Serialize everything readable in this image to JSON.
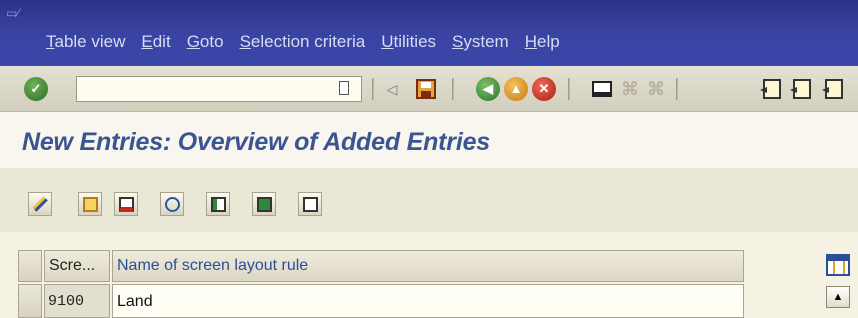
{
  "menubar": {
    "items": [
      {
        "underline": "T",
        "rest": "able view"
      },
      {
        "underline": "E",
        "rest": "dit"
      },
      {
        "underline": "G",
        "rest": "oto"
      },
      {
        "underline": "S",
        "rest": "election criteria"
      },
      {
        "underline": "U",
        "rest": "tilities"
      },
      {
        "underline": "S",
        "rest": "ystem"
      },
      {
        "underline": "H",
        "rest": "elp"
      }
    ]
  },
  "toolbar": {
    "command_value": "",
    "icons": [
      "enter-check-icon",
      "command-history-icon",
      "back-arrow-small-icon",
      "save-icon",
      "back-icon",
      "exit-icon",
      "cancel-icon",
      "print-icon",
      "find-icon",
      "find-next-icon",
      "first-page-icon",
      "previous-page-icon",
      "next-page-icon"
    ]
  },
  "page": {
    "title": "New Entries: Overview of Added Entries"
  },
  "app_toolbar": {
    "icons": [
      "change-display-icon",
      "copy-as-icon",
      "delete-icon",
      "undo-change-icon",
      "select-all-icon",
      "select-block-icon",
      "deselect-all-icon"
    ]
  },
  "table": {
    "columns": [
      "Scre...",
      "Name of screen layout rule"
    ],
    "rows": [
      {
        "key": "9100",
        "name": "Land"
      }
    ]
  },
  "colors": {
    "menubar": "#3a44a3",
    "title": "#3b5592",
    "background": "#f3efe0"
  }
}
